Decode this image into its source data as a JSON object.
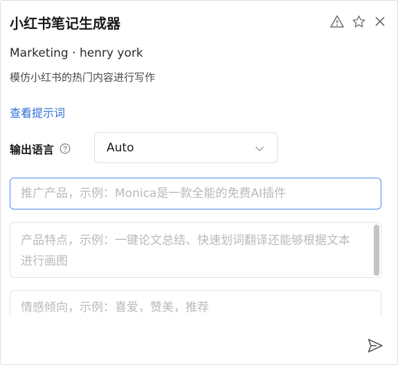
{
  "header": {
    "title": "小红书笔记生成器",
    "actions": [
      "warning-icon",
      "star-icon",
      "close-icon"
    ]
  },
  "meta": {
    "author_line": "Marketing · henry york",
    "description": "模仿小红书的热门内容进行写作",
    "prompt_link": "查看提示词"
  },
  "language": {
    "label": "输出语言",
    "help_icon": "help-icon",
    "selected": "Auto",
    "chevron_icon": "chevron-down-icon"
  },
  "inputs": [
    {
      "placeholder": "推广产品，示例：Monica是一款全能的免费AI插件"
    },
    {
      "placeholder": "产品特点，示例：一键论文总结、快速划词翻译还能够根据文本进行画图"
    },
    {
      "placeholder": "情感倾向，示例：喜爱，赞美，推荐"
    }
  ],
  "footer": {
    "send_icon": "send-icon"
  },
  "colors": {
    "accent": "#4a8cf0",
    "link": "#2f6fd6",
    "placeholder": "#b9b9b9"
  }
}
